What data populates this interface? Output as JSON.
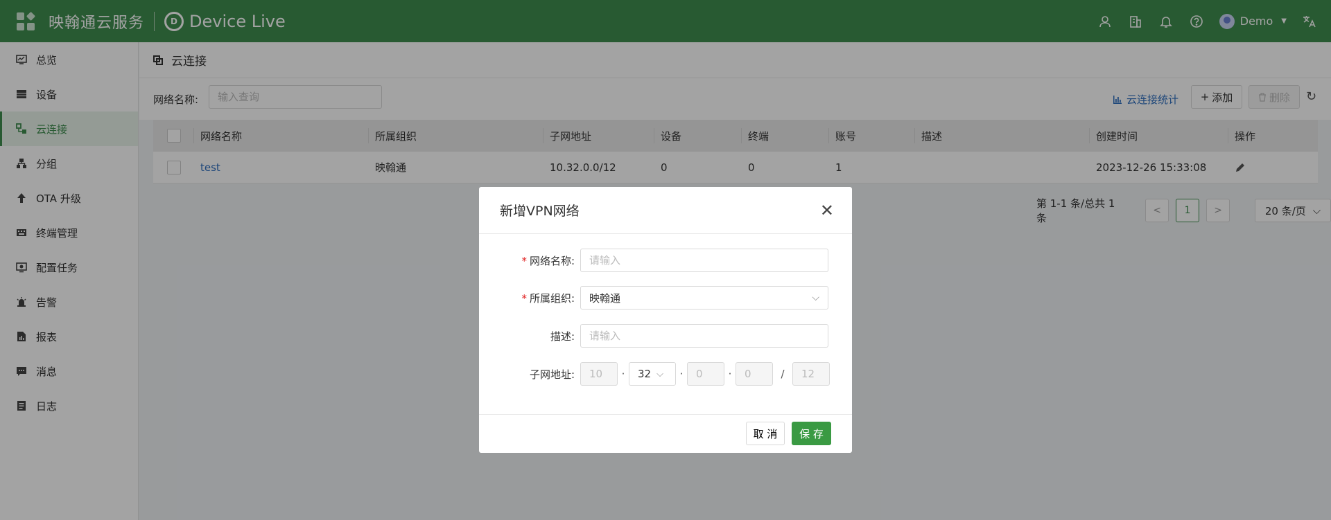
{
  "header": {
    "brand": "映翰通云服务",
    "product": "Device Live",
    "logo_text": "D",
    "user": "Demo",
    "icons": [
      "user-icon",
      "building-icon",
      "bell-icon",
      "help-icon",
      "translate-icon"
    ]
  },
  "sidebar": {
    "items": [
      {
        "label": "总览",
        "icon": "dashboard-icon"
      },
      {
        "label": "设备",
        "icon": "device-icon"
      },
      {
        "label": "云连接",
        "icon": "cloud-connection-icon",
        "active": true
      },
      {
        "label": "分组",
        "icon": "group-icon"
      },
      {
        "label": "OTA 升级",
        "icon": "upload-icon"
      },
      {
        "label": "终端管理",
        "icon": "keyboard-icon"
      },
      {
        "label": "配置任务",
        "icon": "config-icon"
      },
      {
        "label": "告警",
        "icon": "alarm-icon"
      },
      {
        "label": "报表",
        "icon": "report-icon"
      },
      {
        "label": "消息",
        "icon": "message-icon"
      },
      {
        "label": "日志",
        "icon": "log-icon"
      }
    ]
  },
  "page": {
    "title": "云连接",
    "search_label": "网络名称:",
    "search_placeholder": "输入查询",
    "stats_link": "云连接统计",
    "add_button": "添加",
    "delete_button": "删除"
  },
  "table": {
    "columns": [
      "网络名称",
      "所属组织",
      "子网地址",
      "设备",
      "终端",
      "账号",
      "描述",
      "创建时间",
      "操作"
    ],
    "rows": [
      {
        "name": "test",
        "org": "映翰通",
        "subnet": "10.32.0.0/12",
        "devices": "0",
        "terminals": "0",
        "accounts": "1",
        "desc": "",
        "created": "2023-12-26 15:33:08"
      }
    ]
  },
  "pagination": {
    "summary": "第 1-1 条/总共 1 条",
    "current_page": "1",
    "page_size": "20 条/页"
  },
  "modal": {
    "title": "新增VPN网络",
    "fields": {
      "name": {
        "label": "网络名称:",
        "placeholder": "请输入",
        "required": true
      },
      "org": {
        "label": "所属组织:",
        "value": "映翰通",
        "required": true
      },
      "desc": {
        "label": "描述:",
        "placeholder": "请输入"
      },
      "subnet": {
        "label": "子网地址:",
        "octet1": "10",
        "octet2": "32",
        "octet3": "0",
        "octet4": "0",
        "mask": "12",
        "dot": "·",
        "slash": "/"
      }
    },
    "cancel": "取 消",
    "save": "保 存"
  },
  "colors": {
    "header_bg": "#3f8d4f",
    "link": "#2f6fbf",
    "primary_button": "#3a9a43",
    "required": "#e02020"
  }
}
